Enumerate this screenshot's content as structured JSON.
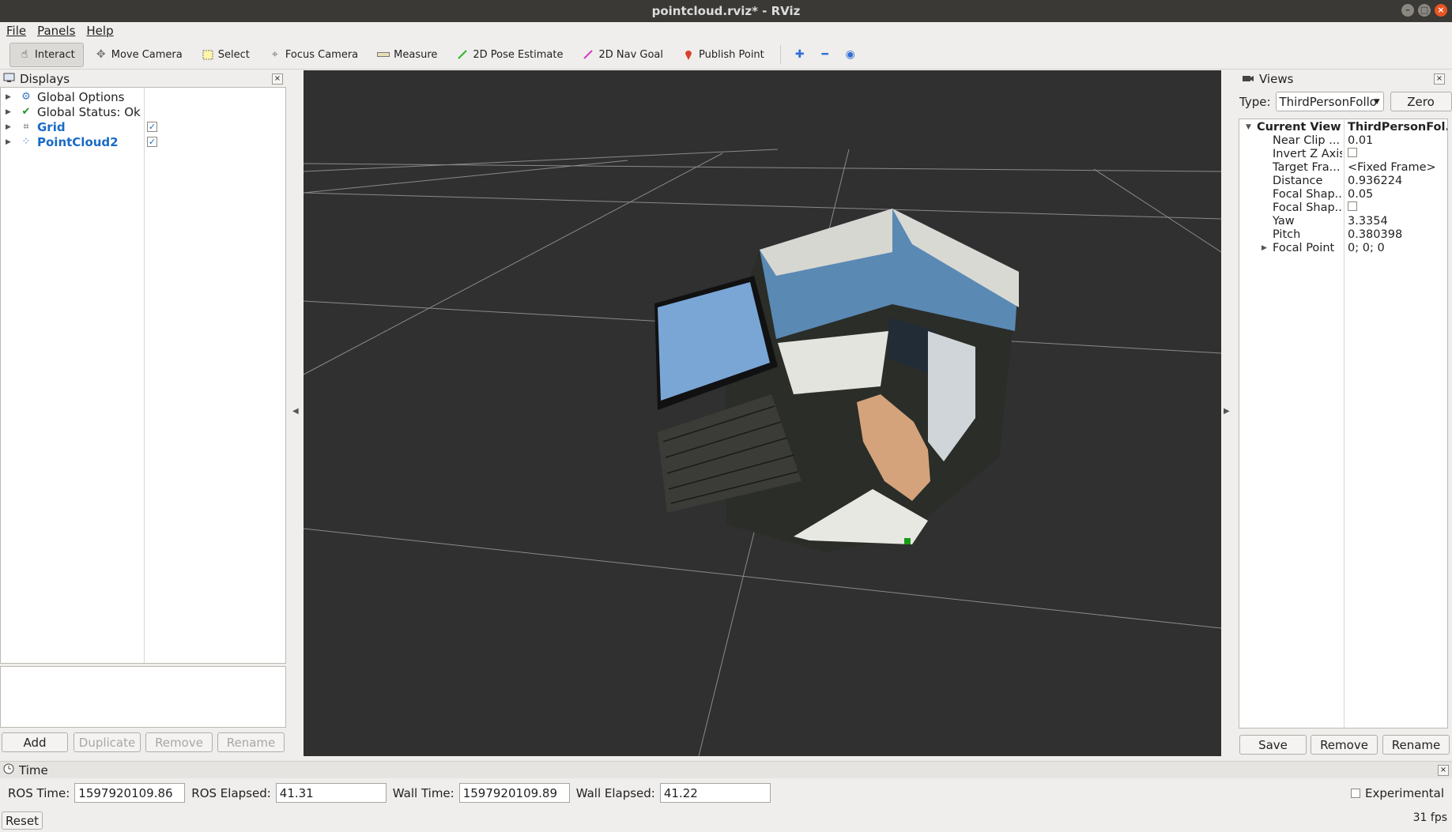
{
  "window": {
    "title": "pointcloud.rviz* - RViz"
  },
  "menu": {
    "file": "File",
    "panels": "Panels",
    "help": "Help"
  },
  "toolbar": {
    "interact": "Interact",
    "move_camera": "Move Camera",
    "select": "Select",
    "focus_camera": "Focus Camera",
    "measure": "Measure",
    "pose_estimate": "2D Pose Estimate",
    "nav_goal": "2D Nav Goal",
    "publish_point": "Publish Point"
  },
  "displays": {
    "title": "Displays",
    "items": [
      {
        "label": "Global Options"
      },
      {
        "label": "Global Status: Ok"
      },
      {
        "label": "Grid",
        "checked": true
      },
      {
        "label": "PointCloud2",
        "checked": true
      }
    ],
    "buttons": {
      "add": "Add",
      "duplicate": "Duplicate",
      "remove": "Remove",
      "rename": "Rename"
    }
  },
  "views": {
    "title": "Views",
    "type_label": "Type:",
    "type_value": "ThirdPersonFollo",
    "zero": "Zero",
    "current_view": {
      "label": "Current View",
      "value": "ThirdPersonFol..."
    },
    "props": [
      {
        "key": "Near Clip ...",
        "value": "0.01"
      },
      {
        "key": "Invert Z Axis",
        "value": ""
      },
      {
        "key": "Target Fra...",
        "value": "<Fixed Frame>"
      },
      {
        "key": "Distance",
        "value": "0.936224"
      },
      {
        "key": "Focal Shap...",
        "value": "0.05"
      },
      {
        "key": "Focal Shap...",
        "value": ""
      },
      {
        "key": "Yaw",
        "value": "3.3354"
      },
      {
        "key": "Pitch",
        "value": "0.380398"
      },
      {
        "key": "Focal Point",
        "value": "0; 0; 0"
      }
    ],
    "buttons": {
      "save": "Save",
      "remove": "Remove",
      "rename": "Rename"
    }
  },
  "time": {
    "title": "Time",
    "ros_time_label": "ROS Time:",
    "ros_time": "1597920109.86",
    "ros_elapsed_label": "ROS Elapsed:",
    "ros_elapsed": "41.31",
    "wall_time_label": "Wall Time:",
    "wall_time": "1597920109.89",
    "wall_elapsed_label": "Wall Elapsed:",
    "wall_elapsed": "41.22",
    "experimental": "Experimental",
    "reset": "Reset",
    "fps": "31 fps"
  }
}
